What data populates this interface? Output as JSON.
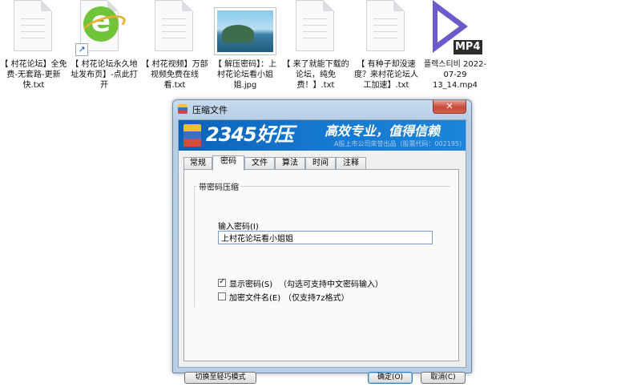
{
  "desktop": {
    "files": [
      {
        "name": "【 村花论坛】全免费-无套路-更新快.txt",
        "icon": "text-file-icon"
      },
      {
        "name": "【 村花论坛永久地址发布页】-点此打开",
        "icon": "ie-shortcut-icon"
      },
      {
        "name": "【 村花视频】万部视频免费在线看.txt",
        "icon": "text-file-icon"
      },
      {
        "name": "【 解压密码】：上村花论坛看小姐姐.jpg",
        "icon": "image-file-icon"
      },
      {
        "name": "【 来了就能下载的论坛，纯免费！】.txt",
        "icon": "text-file-icon"
      },
      {
        "name": "【 有种子却没速度？来村花论坛人工加速】.txt",
        "icon": "text-file-icon"
      },
      {
        "name": "플렉스티비 2022-07-29 13_14.mp4",
        "icon": "video-file-icon",
        "badge": "MP4"
      }
    ]
  },
  "dialog": {
    "title": "压缩文件",
    "close": "✕",
    "banner": {
      "brand": "2345好压",
      "slogan": "高效专业，值得信赖",
      "sub": "A股上市公司荣誉出品（股票代码：002195）"
    },
    "tabs": [
      "常规",
      "密码",
      "文件",
      "算法",
      "时间",
      "注释"
    ],
    "active_tab": "密码",
    "password_section": {
      "group_title": "带密码压缩",
      "input_label": "输入密码(I)",
      "password_value": "上村花论坛看小姐姐",
      "show_password_label": "显示密码(S)",
      "show_password_checked": true,
      "show_password_hint": "（勾选可支持中文密码输入）",
      "encrypt_names_label": "加密文件名(E)",
      "encrypt_names_checked": false,
      "encrypt_names_hint": "（仅支持7z格式）"
    },
    "buttons": {
      "switch_mode": "切换至轻巧模式",
      "ok": "确定(O)",
      "cancel": "取消(C)"
    }
  }
}
